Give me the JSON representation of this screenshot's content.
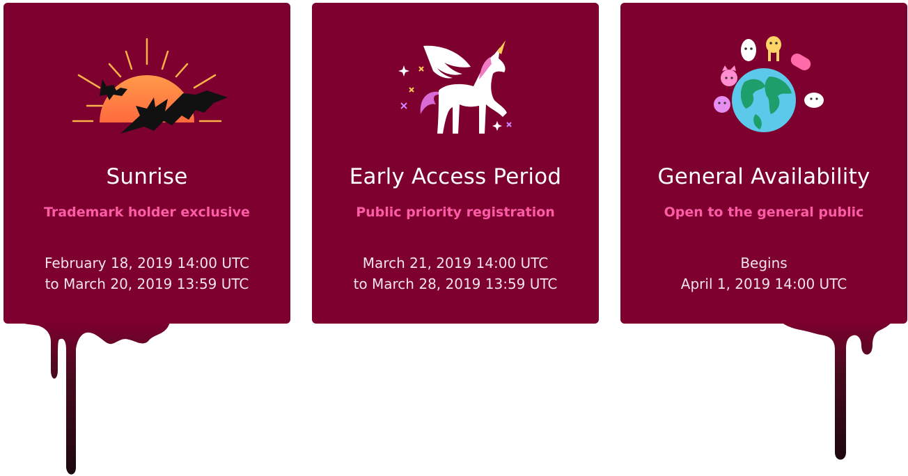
{
  "phases": [
    {
      "id": "sunrise",
      "title": "Sunrise",
      "subtitle": "Trademark holder exclusive",
      "date_line1": "February 18, 2019 14:00 UTC",
      "date_line2": "to March 20, 2019 13:59 UTC",
      "icon": "sunrise-with-bats-icon"
    },
    {
      "id": "early-access",
      "title": "Early Access Period",
      "subtitle": "Public priority registration",
      "date_line1": "March 21, 2019 14:00 UTC",
      "date_line2": "to March 28, 2019 13:59 UTC",
      "icon": "pegasus-unicorn-icon"
    },
    {
      "id": "general-availability",
      "title": "General Availability",
      "subtitle": "Open to the general public",
      "date_line1": "Begins",
      "date_line2": "April 1, 2019 14:00 UTC",
      "icon": "globe-with-monsters-icon"
    }
  ],
  "colors": {
    "card_bg": "#7d002e",
    "subtitle": "#ff5ca8",
    "drip_dark": "#2a0a14"
  }
}
